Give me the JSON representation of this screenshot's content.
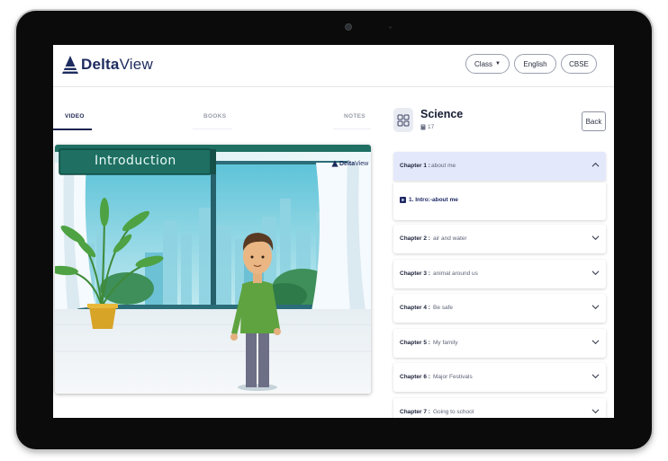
{
  "app": {
    "logo_bold": "Delta",
    "logo_thin": "View"
  },
  "header": {
    "class_label": "Class",
    "language_label": "English",
    "board_label": "CBSE"
  },
  "tabs": [
    {
      "label": "VIDEO",
      "active": true
    },
    {
      "label": "BOOKS",
      "active": false
    },
    {
      "label": "NOTES",
      "active": false
    }
  ],
  "video": {
    "banner_text": "Introduction",
    "watermark_bold": "Delta",
    "watermark_thin": "View"
  },
  "subject": {
    "title": "Science",
    "count": "17",
    "back_label": "Back",
    "icon": "grid-apps-icon"
  },
  "chapters": [
    {
      "num": "Chapter 1 :",
      "title": "about me",
      "open": true,
      "lessons": [
        {
          "label": "1. Intro:-about me",
          "icon": "video-file-icon"
        }
      ]
    },
    {
      "num": "Chapter 2 :",
      "title": "air and water",
      "open": false
    },
    {
      "num": "Chapter 3 :",
      "title": "animal around us",
      "open": false
    },
    {
      "num": "Chapter 4 :",
      "title": "Be safe",
      "open": false
    },
    {
      "num": "Chapter 5 :",
      "title": "My family",
      "open": false
    },
    {
      "num": "Chapter 6 :",
      "title": "Major Festivals",
      "open": false
    },
    {
      "num": "Chapter 7 :",
      "title": "Going to school",
      "open": false
    }
  ],
  "colors": {
    "brand": "#1d2b5e",
    "open_chapter_bg": "#e4e8fb",
    "banner_green": "#1f6f63"
  }
}
